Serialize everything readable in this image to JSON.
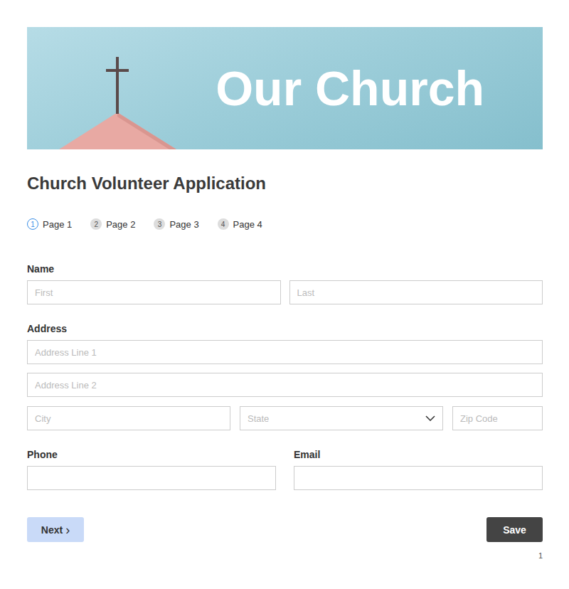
{
  "banner": {
    "title": "Our Church"
  },
  "form": {
    "title": "Church Volunteer Application"
  },
  "steps": [
    {
      "number": "1",
      "label": "Page 1",
      "selected": true
    },
    {
      "number": "2",
      "label": "Page 2",
      "selected": false
    },
    {
      "number": "3",
      "label": "Page 3",
      "selected": false
    },
    {
      "number": "4",
      "label": "Page 4",
      "selected": false
    }
  ],
  "name": {
    "label": "Name",
    "first": {
      "placeholder": "First"
    },
    "last": {
      "placeholder": "Last"
    }
  },
  "address": {
    "label": "Address",
    "line1": {
      "placeholder": "Address Line 1"
    },
    "line2": {
      "placeholder": "Address Line 2"
    },
    "city": {
      "placeholder": "City"
    },
    "state": {
      "placeholder": "State"
    },
    "zip": {
      "placeholder": "Zip Code"
    }
  },
  "phone": {
    "label": "Phone"
  },
  "email": {
    "label": "Email"
  },
  "buttons": {
    "next": {
      "label": "Next",
      "icon": "›"
    },
    "save": {
      "label": "Save"
    }
  },
  "page_number": "1"
}
